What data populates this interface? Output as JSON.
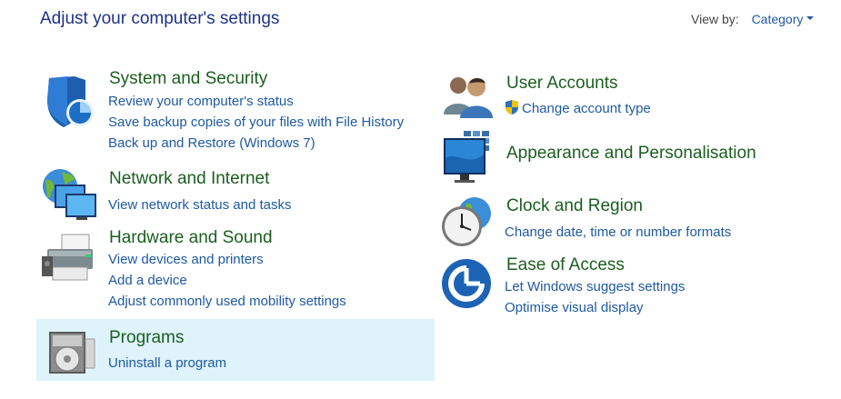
{
  "page": {
    "title": "Adjust your computer's settings"
  },
  "view_by": {
    "label": "View by:",
    "value": "Category"
  },
  "left_column": [
    {
      "title": "System and Security",
      "icon": "shield-icon",
      "links": [
        "Review your computer's status",
        "Save backup copies of your files with File History",
        "Back up and Restore (Windows 7)"
      ]
    },
    {
      "title": "Network and Internet",
      "icon": "network-globe-icon",
      "links": [
        "View network status and tasks"
      ]
    },
    {
      "title": "Hardware and Sound",
      "icon": "printer-icon",
      "links": [
        "View devices and printers",
        "Add a device",
        "Adjust commonly used mobility settings"
      ]
    },
    {
      "title": "Programs",
      "icon": "programs-icon",
      "selected": true,
      "links": [
        "Uninstall a program"
      ]
    }
  ],
  "right_column": [
    {
      "title": "User Accounts",
      "icon": "users-icon",
      "links": [
        "Change account type"
      ],
      "link_icons": [
        "uac-shield-icon"
      ]
    },
    {
      "title": "Appearance and Personalisation",
      "icon": "monitor-icon",
      "links": []
    },
    {
      "title": "Clock and Region",
      "icon": "clock-globe-icon",
      "links": [
        "Change date, time or number formats"
      ]
    },
    {
      "title": "Ease of Access",
      "icon": "ease-of-access-icon",
      "links": [
        "Let Windows suggest settings",
        "Optimise visual display"
      ]
    }
  ],
  "colors": {
    "title": "#1e3287",
    "category": "#1b5e20",
    "link": "#1e5aa0",
    "selected_bg": "#dff3fb"
  }
}
